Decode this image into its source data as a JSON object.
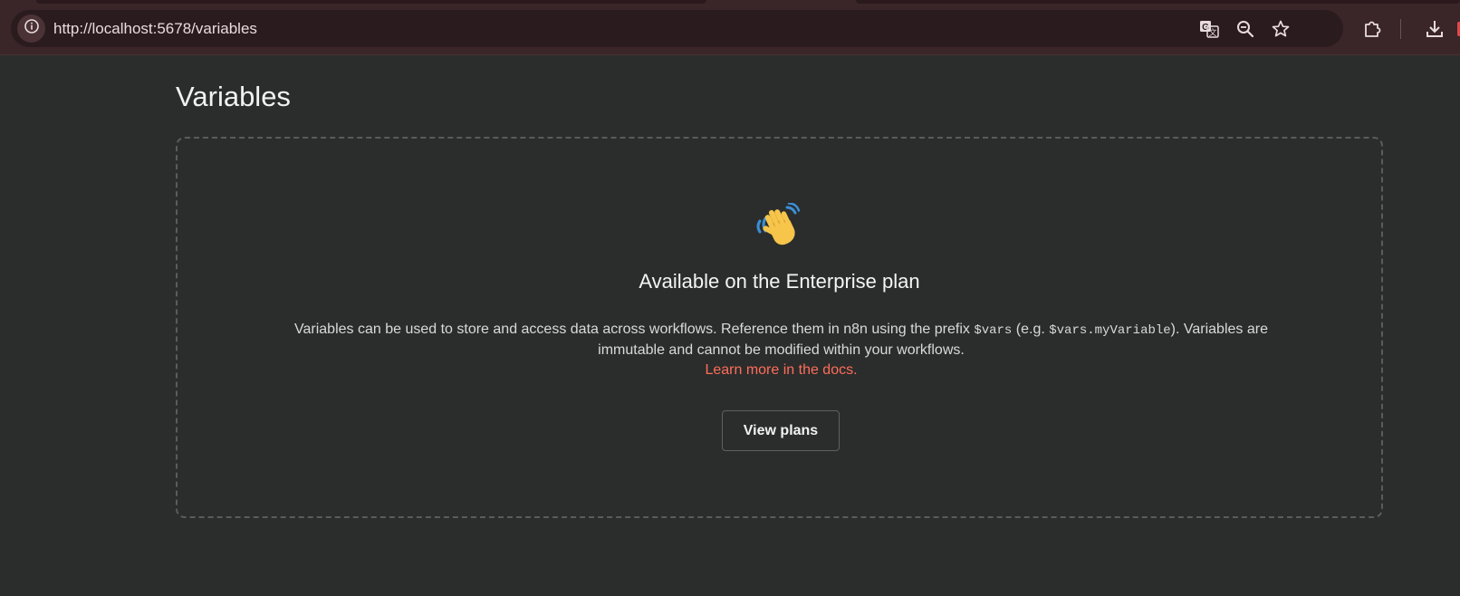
{
  "browser": {
    "url": "http://localhost:5678/variables",
    "icons": [
      "info-icon",
      "translate-icon",
      "zoom-out-icon",
      "bookmark-star-icon",
      "extensions-icon",
      "download-icon"
    ]
  },
  "page": {
    "title": "Variables"
  },
  "empty_state": {
    "emoji": "👋",
    "heading": "Available on the Enterprise plan",
    "desc_part1": "Variables can be used to store and access data across workflows. Reference them in n8n using the prefix ",
    "code_vars": "$vars",
    "desc_part2": " (e.g. ",
    "code_example": "$vars.myVariable",
    "desc_part3": "). Variables are immutable and cannot be modified within your workflows.",
    "link_label": "Learn more in the docs.",
    "button_label": "View plans"
  },
  "colors": {
    "page_bg": "#2b2d2c",
    "chrome_bg": "#3a2529",
    "link": "#ff6d5a",
    "wave_hand": "#f6c54a",
    "wave_lines": "#3b8fd6"
  }
}
